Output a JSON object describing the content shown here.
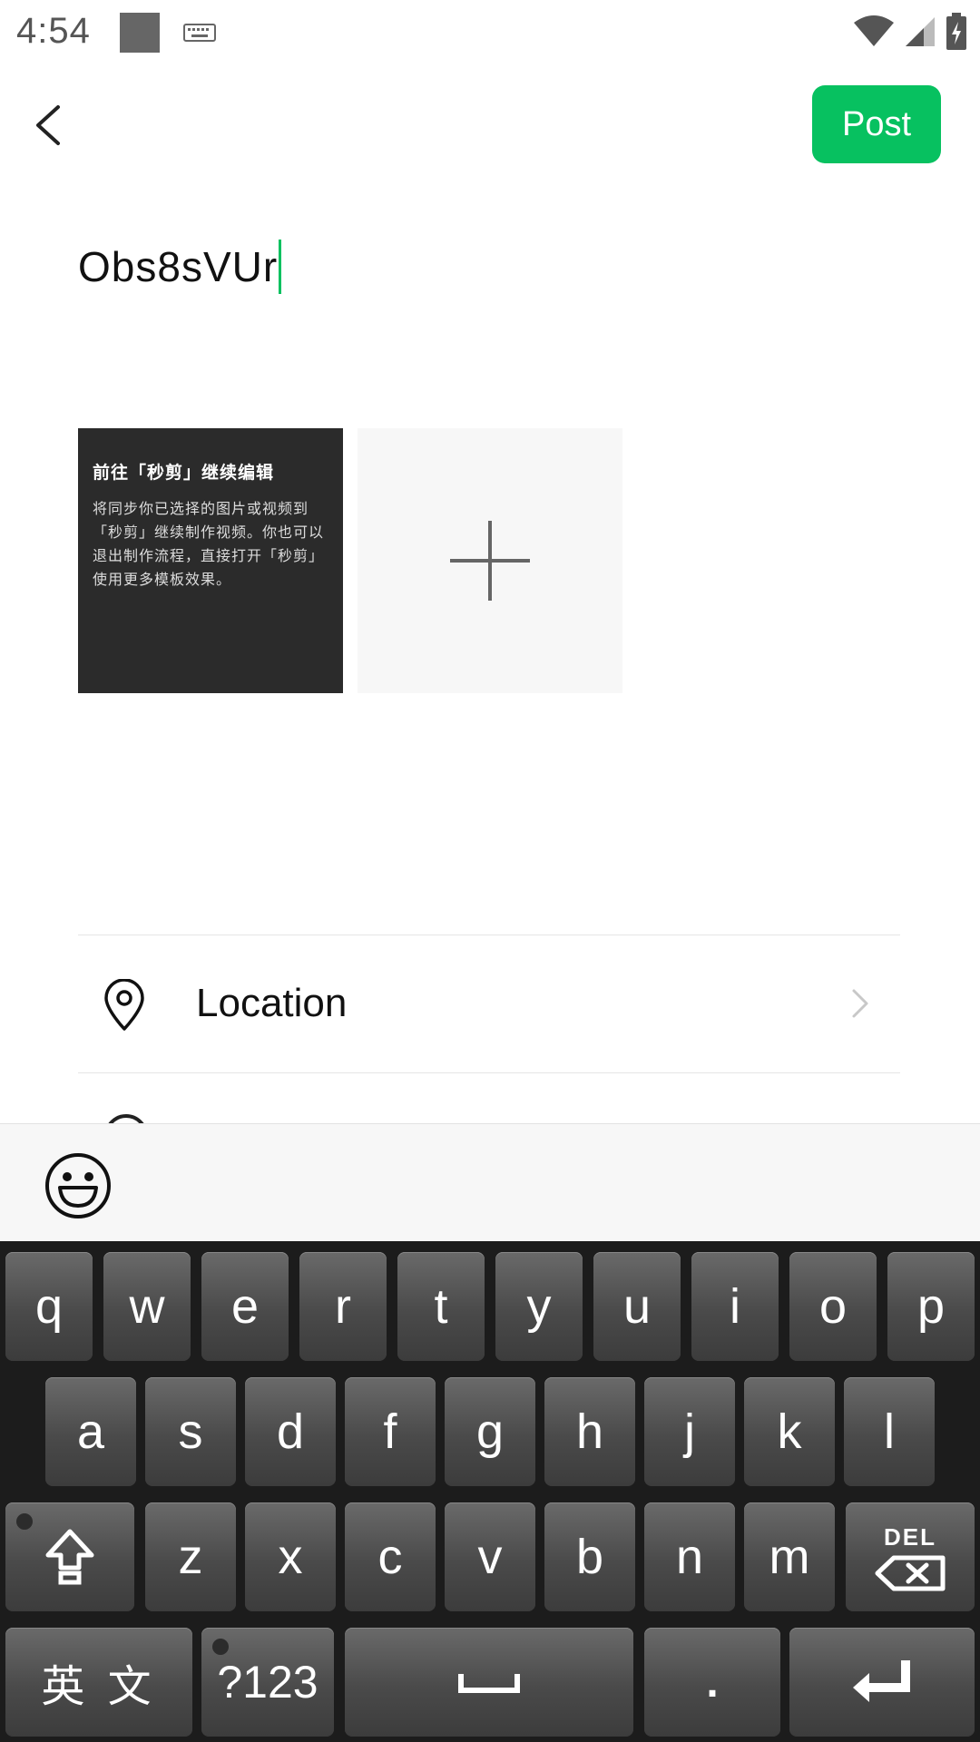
{
  "status_bar": {
    "time": "4:54"
  },
  "header": {
    "post_label": "Post"
  },
  "composer": {
    "text": "Obs8sVUr"
  },
  "media": {
    "thumb_title": "前往「秒剪」继续编辑",
    "thumb_body": "将同步你已选择的图片或视频到「秒剪」继续制作视频。你也可以退出制作流程，直接打开「秒剪」使用更多模板效果。"
  },
  "options": {
    "location_label": "Location"
  },
  "keyboard": {
    "row1": [
      "q",
      "w",
      "e",
      "r",
      "t",
      "y",
      "u",
      "i",
      "o",
      "p"
    ],
    "row2": [
      "a",
      "s",
      "d",
      "f",
      "g",
      "h",
      "j",
      "k",
      "l"
    ],
    "row3": [
      "z",
      "x",
      "c",
      "v",
      "b",
      "n",
      "m"
    ],
    "del_label": "DEL",
    "lang_label": "英 文",
    "symbols_label": "?123",
    "period_label": "."
  },
  "colors": {
    "accent": "#07c160",
    "keyboard_bg": "#1c1c1c"
  },
  "icons": [
    "back-arrow",
    "location-pin",
    "chevron-right",
    "emoji-face",
    "shift-arrow",
    "backspace",
    "enter-arrow",
    "wifi",
    "signal",
    "battery"
  ]
}
